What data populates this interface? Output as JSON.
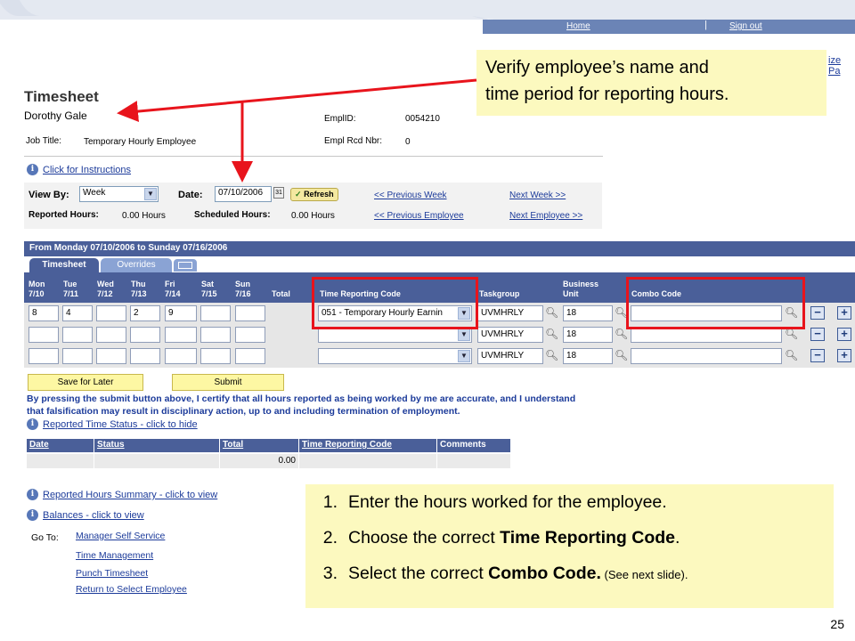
{
  "header": {
    "home": "Home",
    "separator": "|",
    "signout": "Sign out",
    "cut_text": "ize Pa"
  },
  "page": {
    "title": "Timesheet",
    "employee_name": "Dorothy Gale",
    "job_title_label": "Job Title:",
    "job_title": "Temporary Hourly Employee",
    "emplid_label": "EmplID:",
    "emplid": "0054210",
    "empl_rcd_label": "Empl Rcd Nbr:",
    "empl_rcd": "0",
    "instructions": "Click for Instructions"
  },
  "filters": {
    "viewby_label": "View By:",
    "viewby_value": "Week",
    "date_label": "Date:",
    "date_value": "07/10/2006",
    "refresh": "Refresh",
    "prev_week": "<< Previous Week",
    "next_week": "Next Week >>",
    "reported_label": "Reported Hours:",
    "reported_value": "0.00 Hours",
    "scheduled_label": "Scheduled Hours:",
    "scheduled_value": "0.00 Hours",
    "prev_employee": "<< Previous Employee",
    "next_employee": "Next Employee >>"
  },
  "period": "From Monday 07/10/2006 to Sunday 07/16/2006",
  "tabs": {
    "timesheet": "Timesheet",
    "overrides": "Overrides"
  },
  "grid": {
    "days": [
      {
        "day": "Mon",
        "date": "7/10"
      },
      {
        "day": "Tue",
        "date": "7/11"
      },
      {
        "day": "Wed",
        "date": "7/12"
      },
      {
        "day": "Thu",
        "date": "7/13"
      },
      {
        "day": "Fri",
        "date": "7/14"
      },
      {
        "day": "Sat",
        "date": "7/15"
      },
      {
        "day": "Sun",
        "date": "7/16"
      }
    ],
    "total": "Total",
    "trc": "Time Reporting Code",
    "taskgroup": "Taskgroup",
    "bu_1": "Business",
    "bu_2": "Unit",
    "combo": "Combo Code",
    "rows": [
      {
        "hours": [
          "8",
          "4",
          "",
          "2",
          "9",
          "",
          ""
        ],
        "trc": "051 - Temporary Hourly Earnin",
        "taskgroup": "UVMHRLY",
        "bu": "18",
        "combo": ""
      },
      {
        "hours": [
          "",
          "",
          "",
          "",
          "",
          "",
          ""
        ],
        "trc": "",
        "taskgroup": "UVMHRLY",
        "bu": "18",
        "combo": ""
      },
      {
        "hours": [
          "",
          "",
          "",
          "",
          "",
          "",
          ""
        ],
        "trc": "",
        "taskgroup": "UVMHRLY",
        "bu": "18",
        "combo": ""
      }
    ]
  },
  "actions": {
    "save": "Save for Later",
    "submit": "Submit"
  },
  "certification": "By pressing the submit button above, I certify that all hours reported as being worked by me are accurate, and I understand that falsification may result in disciplinary action, up to and including termination of employment.",
  "reported_status": {
    "link": "Reported Time Status - click to hide",
    "columns": [
      "Date",
      "Status",
      "Total",
      "Time Reporting Code",
      "Comments"
    ],
    "row": [
      "",
      "",
      "0.00",
      "",
      ""
    ]
  },
  "links": {
    "summary": "Reported Hours Summary - click to view",
    "balances": "Balances - click to view",
    "goto_label": "Go To:",
    "manager": "Manager Self Service",
    "time_mgmt": "Time Management",
    "punch": "Punch Timesheet",
    "return": "Return to Select Employee"
  },
  "callouts": {
    "top_line1": "Verify employee’s name and",
    "top_line2": "time period for reporting hours.",
    "s1_num": "1.",
    "s1": "Enter the hours worked for the employee.",
    "s2_num": "2.",
    "s2_pre": "Choose the correct ",
    "s2_bold": "Time Reporting Code",
    "s2_post": ".",
    "s3_num": "3.",
    "s3_pre": "Select the correct ",
    "s3_bold": "Combo Code.",
    "s3_small": " (See next slide)."
  },
  "slide_number": "25",
  "colors": {
    "header_blue": "#4a5f99",
    "accent_red": "#e8141c",
    "callout_yellow": "#fcf9bf",
    "link_blue": "#1c3b9a"
  }
}
